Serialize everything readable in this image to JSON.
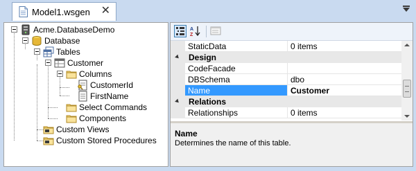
{
  "document_tab": {
    "title": "Model1.wsgen",
    "close_glyph": "✕"
  },
  "tree": {
    "nodes": [
      {
        "label": "Acme.DatabaseDemo",
        "icon": "database-server-icon"
      },
      {
        "label": "Database",
        "icon": "database-icon"
      },
      {
        "label": "Tables",
        "icon": "tables-icon"
      },
      {
        "label": "Customer",
        "icon": "table-icon"
      },
      {
        "label": "Columns",
        "icon": "folder-icon"
      },
      {
        "label": "CustomerId",
        "icon": "key-column-icon"
      },
      {
        "label": "FirstName",
        "icon": "column-icon"
      },
      {
        "label": "Select Commands",
        "icon": "folder-icon"
      },
      {
        "label": "Components",
        "icon": "folder-icon"
      },
      {
        "label": "Custom Views",
        "icon": "views-folder-icon"
      },
      {
        "label": "Custom Stored Procedures",
        "icon": "procedures-folder-icon"
      }
    ]
  },
  "property_grid": {
    "toolbar": {
      "categorized": "categorized-view-icon",
      "alphabetical": "sort-alphabetical-icon",
      "property_pages": "property-pages-icon"
    },
    "rows": [
      {
        "type": "prop",
        "name": "StaticData",
        "value": "0 items"
      },
      {
        "type": "cat",
        "name": "Design"
      },
      {
        "type": "prop",
        "name": "CodeFacade",
        "value": ""
      },
      {
        "type": "prop",
        "name": "DBSchema",
        "value": "dbo"
      },
      {
        "type": "prop",
        "name": "Name",
        "value": "Customer",
        "selected": true
      },
      {
        "type": "cat",
        "name": "Relations"
      },
      {
        "type": "prop",
        "name": "Relationships",
        "value": "0 items"
      }
    ],
    "description": {
      "title": "Name",
      "text": "Determines the name of this table."
    }
  },
  "colors": {
    "frame": "#c9daf0",
    "selection": "#3399ff",
    "category_bg": "#e8e8e8"
  }
}
